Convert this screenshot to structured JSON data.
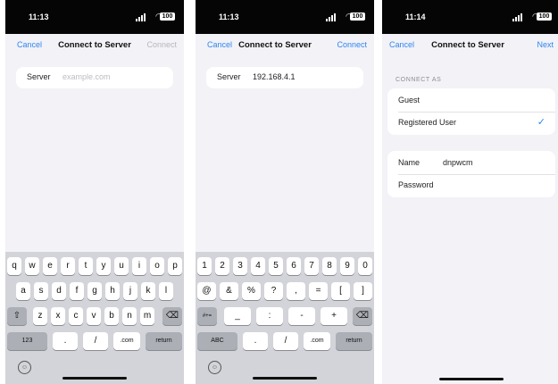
{
  "screens": [
    {
      "status_time": "11:13",
      "battery": "100",
      "nav": {
        "cancel": "Cancel",
        "title": "Connect to Server",
        "action": "Connect",
        "action_enabled": false
      },
      "server_field": {
        "label": "Server",
        "value": "",
        "placeholder": "example.com"
      },
      "keyboard": {
        "row1": [
          "q",
          "w",
          "e",
          "r",
          "t",
          "y",
          "u",
          "i",
          "o",
          "p"
        ],
        "row2": [
          "a",
          "s",
          "d",
          "f",
          "g",
          "h",
          "j",
          "k",
          "l"
        ],
        "row3": [
          "z",
          "x",
          "c",
          "v",
          "b",
          "n",
          "m"
        ],
        "shift_glyph": "⇧",
        "delete_glyph": "⌫",
        "bottom": [
          "123",
          ".",
          "/",
          ".com",
          "return"
        ],
        "emoji_glyph": "☺"
      }
    },
    {
      "status_time": "11:13",
      "battery": "100",
      "nav": {
        "cancel": "Cancel",
        "title": "Connect to Server",
        "action": "Connect",
        "action_enabled": true
      },
      "server_field": {
        "label": "Server",
        "value": "192.168.4.1",
        "placeholder": ""
      },
      "keyboard": {
        "row1": [
          "1",
          "2",
          "3",
          "4",
          "5",
          "6",
          "7",
          "8",
          "9",
          "0"
        ],
        "row2": [
          "@",
          "&",
          "%",
          "?",
          ",",
          "=",
          "[",
          "]"
        ],
        "row3": [
          "_",
          ":",
          "-",
          "+"
        ],
        "shift_glyph": "#+=",
        "delete_glyph": "⌫",
        "bottom": [
          "ABC",
          ".",
          "/",
          ".com",
          "return"
        ],
        "emoji_glyph": "☺"
      }
    },
    {
      "status_time": "11:14",
      "battery": "100",
      "nav": {
        "cancel": "Cancel",
        "title": "Connect to Server",
        "action": "Next",
        "action_enabled": true
      },
      "section_header": "CONNECT AS",
      "options": [
        {
          "label": "Guest",
          "selected": false
        },
        {
          "label": "Registered User",
          "selected": true
        }
      ],
      "check_glyph": "✓",
      "credentials": {
        "name_label": "Name",
        "name_value": "dnpwcm",
        "password_label": "Password",
        "password_value": ""
      }
    }
  ],
  "colors": {
    "accent": "#2f86ef",
    "background": "#f2f2f7",
    "keyboard_bg": "#d3d4d9"
  }
}
